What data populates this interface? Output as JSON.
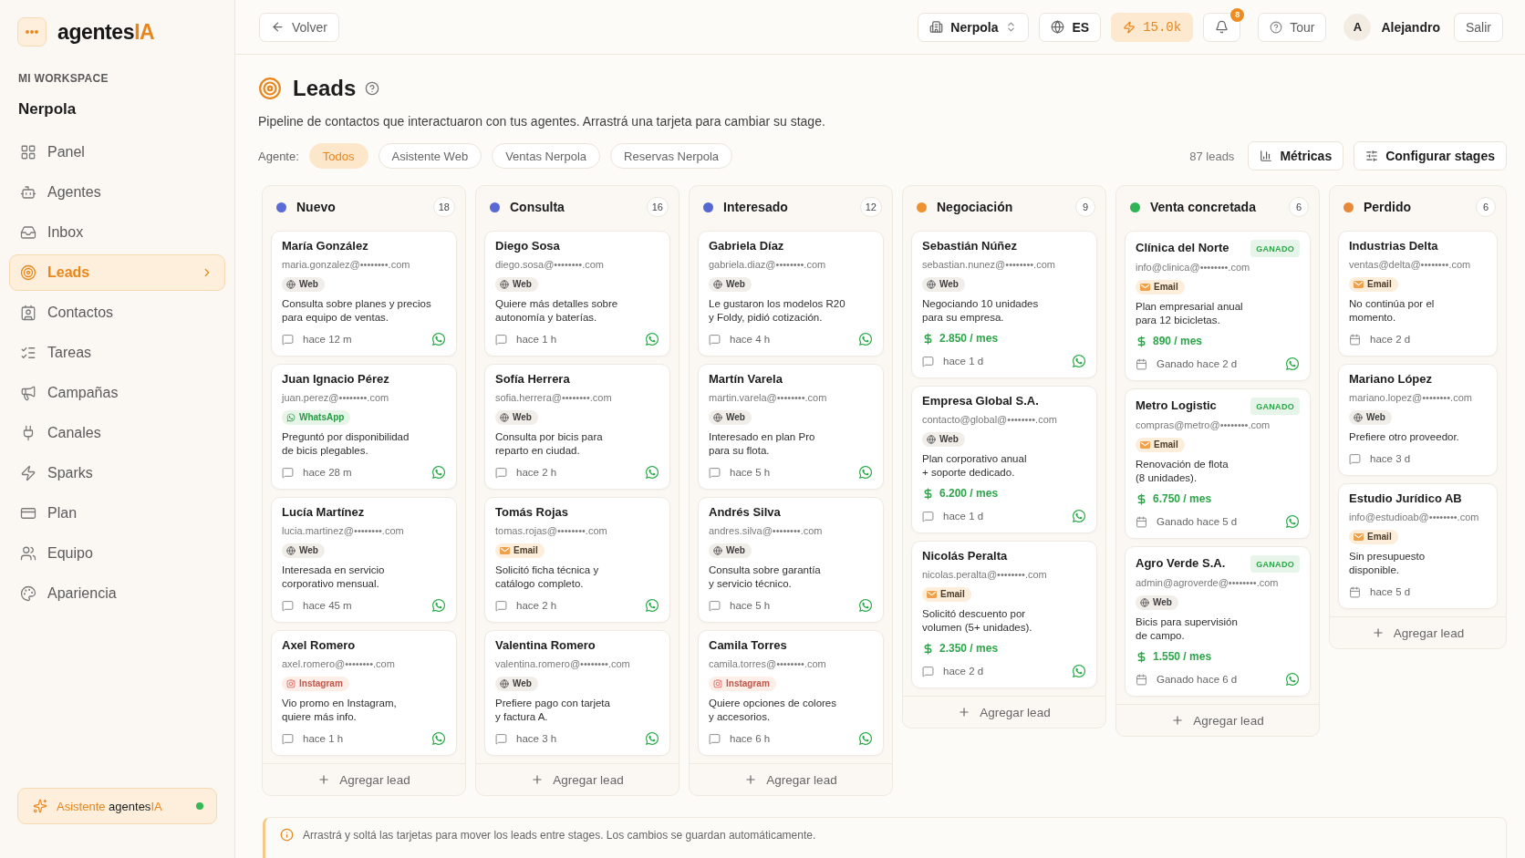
{
  "sidebar": {
    "logo": {
      "name": "agentes",
      "accent": "IA"
    },
    "workspace_label": "MI WORKSPACE",
    "workspace": "Nerpola",
    "items": [
      {
        "label": "Panel",
        "selected": false
      },
      {
        "label": "Agentes",
        "selected": false
      },
      {
        "label": "Inbox",
        "selected": false
      },
      {
        "label": "Leads",
        "selected": true
      },
      {
        "label": "Contactos",
        "selected": false
      },
      {
        "label": "Tareas",
        "selected": false
      },
      {
        "label": "Campañas",
        "selected": false
      },
      {
        "label": "Canales",
        "selected": false
      },
      {
        "label": "Sparks",
        "selected": false
      },
      {
        "label": "Plan",
        "selected": false
      },
      {
        "label": "Equipo",
        "selected": false
      },
      {
        "label": "Apariencia",
        "selected": false
      }
    ],
    "assistant": {
      "label": "Asistente",
      "brand": "agentes",
      "accent": "IA",
      "online": true
    }
  },
  "topbar": {
    "back": "Volver",
    "workspace_select": "Nerpola",
    "language": "ES",
    "credits": "15.0k",
    "notifications": "8",
    "tour": "Tour",
    "user": {
      "initial": "A",
      "name": "Alejandro"
    },
    "logout": "Salir"
  },
  "page": {
    "title": "Leads",
    "description": "Pipeline de contactos que interactuaron con tus agentes. Arrastrá una tarjeta para cambiar su stage.",
    "filter_label": "Agente:",
    "filters": [
      {
        "label": "Todos",
        "selected": true
      },
      {
        "label": "Asistente Web",
        "selected": false
      },
      {
        "label": "Ventas Nerpola",
        "selected": false
      },
      {
        "label": "Reservas Nerpola",
        "selected": false
      }
    ],
    "count": "87 leads",
    "actions": [
      "Métricas",
      "Configurar stages"
    ]
  },
  "stages": [
    {
      "name": "Nuevo",
      "color": "#5a6ad6",
      "count": "18",
      "add_label": "Agregar lead",
      "leads": [
        {
          "name": "María González",
          "email": "maria.gonzalez@••••••••.com",
          "source": {
            "kind": "web",
            "label": "Web"
          },
          "note": "Consulta sobre planes y precios\npara equipo de ventas.",
          "time": "hace 12 m",
          "kind": "open",
          "whatsapp": true
        },
        {
          "name": "Juan Ignacio Pérez",
          "email": "juan.perez@••••••••.com",
          "source": {
            "kind": "whatsapp",
            "label": "WhatsApp"
          },
          "note": "Preguntó por disponibilidad\nde bicis plegables.",
          "time": "hace 28 m",
          "kind": "open",
          "whatsapp": true
        },
        {
          "name": "Lucía Martínez",
          "email": "lucia.martinez@••••••••.com",
          "source": {
            "kind": "web",
            "label": "Web"
          },
          "note": "Interesada en servicio\ncorporativo mensual.",
          "time": "hace 45 m",
          "kind": "open",
          "whatsapp": true
        },
        {
          "name": "Axel Romero",
          "email": "axel.romero@••••••••.com",
          "source": {
            "kind": "instagram",
            "label": "Instagram"
          },
          "note": "Vio promo en Instagram,\nquiere más info.",
          "time": "hace 1 h",
          "kind": "open",
          "whatsapp": true
        }
      ]
    },
    {
      "name": "Consulta",
      "color": "#5868d4",
      "count": "16",
      "add_label": "Agregar lead",
      "leads": [
        {
          "name": "Diego Sosa",
          "email": "diego.sosa@••••••••.com",
          "source": {
            "kind": "web",
            "label": "Web"
          },
          "note": "Quiere más detalles sobre\nautonomía y baterías.",
          "time": "hace 1 h",
          "kind": "open",
          "whatsapp": true
        },
        {
          "name": "Sofía Herrera",
          "email": "sofia.herrera@••••••••.com",
          "source": {
            "kind": "web",
            "label": "Web"
          },
          "note": "Consulta por bicis para\nreparto en ciudad.",
          "time": "hace 2 h",
          "kind": "open",
          "whatsapp": true
        },
        {
          "name": "Tomás Rojas",
          "email": "tomas.rojas@••••••••.com",
          "source": {
            "kind": "email",
            "label": "Email"
          },
          "note": "Solicitó ficha técnica y\ncatálogo completo.",
          "time": "hace 2 h",
          "kind": "open",
          "whatsapp": true
        },
        {
          "name": "Valentina Romero",
          "email": "valentina.romero@••••••••.com",
          "source": {
            "kind": "web",
            "label": "Web"
          },
          "note": "Prefiere pago con tarjeta\ny factura A.",
          "time": "hace 3 h",
          "kind": "open",
          "whatsapp": true
        }
      ]
    },
    {
      "name": "Interesado",
      "color": "#5666d2",
      "count": "12",
      "add_label": "Agregar lead",
      "leads": [
        {
          "name": "Gabriela Díaz",
          "email": "gabriela.diaz@••••••••.com",
          "source": {
            "kind": "web",
            "label": "Web"
          },
          "note": "Le gustaron los modelos R20\ny Foldy, pidió cotización.",
          "time": "hace 4 h",
          "kind": "open",
          "whatsapp": true
        },
        {
          "name": "Martín Varela",
          "email": "martin.varela@••••••••.com",
          "source": {
            "kind": "web",
            "label": "Web"
          },
          "note": "Interesado en plan Pro\npara su flota.",
          "time": "hace 5 h",
          "kind": "open",
          "whatsapp": true
        },
        {
          "name": "Andrés Silva",
          "email": "andres.silva@••••••••.com",
          "source": {
            "kind": "web",
            "label": "Web"
          },
          "note": "Consulta sobre garantía\ny servicio técnico.",
          "time": "hace 5 h",
          "kind": "open",
          "whatsapp": true
        },
        {
          "name": "Camila Torres",
          "email": "camila.torres@••••••••.com",
          "source": {
            "kind": "instagram",
            "label": "Instagram"
          },
          "note": "Quiere opciones de colores\ny accesorios.",
          "time": "hace 6 h",
          "kind": "open",
          "whatsapp": true
        }
      ]
    },
    {
      "name": "Negociación",
      "color": "#ee9130",
      "count": "9",
      "add_label": "Agregar lead",
      "leads": [
        {
          "name": "Sebastián Núñez",
          "email": "sebastian.nunez@••••••••.com",
          "source": {
            "kind": "web",
            "label": "Web"
          },
          "note": "Negociando 10 unidades\npara su empresa.",
          "value": "2.850 / mes",
          "time": "hace 1 d",
          "kind": "open",
          "whatsapp": true
        },
        {
          "name": "Empresa Global S.A.",
          "email": "contacto@global@••••••••.com",
          "source": {
            "kind": "web",
            "label": "Web"
          },
          "note": "Plan corporativo anual\n+ soporte dedicado.",
          "value": "6.200 / mes",
          "time": "hace 1 d",
          "kind": "open",
          "whatsapp": true
        },
        {
          "name": "Nicolás Peralta",
          "email": "nicolas.peralta@••••••••.com",
          "source": {
            "kind": "email",
            "label": "Email"
          },
          "note": "Solicitó descuento por\nvolumen (5+ unidades).",
          "value": "2.350 / mes",
          "time": "hace 2 d",
          "kind": "open",
          "whatsapp": true
        }
      ]
    },
    {
      "name": "Venta concretada",
      "color": "#2fb356",
      "count": "6",
      "add_label": "Agregar lead",
      "leads": [
        {
          "name": "Clínica del Norte",
          "badge": "GANADO",
          "email": "info@clinica@••••••••.com",
          "source": {
            "kind": "email",
            "label": "Email"
          },
          "note": "Plan empresarial anual\npara 12 bicicletas.",
          "value": "890 / mes",
          "time": "Ganado hace 2 d",
          "kind": "closed",
          "whatsapp": true
        },
        {
          "name": "Metro Logistic",
          "badge": "GANADO",
          "email": "compras@metro@••••••••.com",
          "source": {
            "kind": "email",
            "label": "Email"
          },
          "note": "Renovación de flota\n(8 unidades).",
          "value": "6.750 / mes",
          "time": "Ganado hace 5 d",
          "kind": "closed",
          "whatsapp": true
        },
        {
          "name": "Agro Verde S.A.",
          "badge": "GANADO",
          "email": "admin@agroverde@••••••••.com",
          "source": {
            "kind": "web",
            "label": "Web"
          },
          "note": "Bicis para supervisión\nde campo.",
          "value": "1.550 / mes",
          "time": "Ganado hace 6 d",
          "kind": "closed",
          "whatsapp": true
        }
      ]
    },
    {
      "name": "Perdido",
      "color": "#e8893a",
      "count": "6",
      "add_label": "Agregar lead",
      "leads": [
        {
          "name": "Industrias Delta",
          "email": "ventas@delta@••••••••.com",
          "source": {
            "kind": "email",
            "label": "Email"
          },
          "note": "No continúa por el\nmomento.",
          "time": "hace 2 d",
          "kind": "closed",
          "whatsapp": false
        },
        {
          "name": "Mariano López",
          "email": "mariano.lopez@••••••••.com",
          "source": {
            "kind": "web",
            "label": "Web"
          },
          "note": "Prefiere otro proveedor.",
          "time": "hace 3 d",
          "kind": "open",
          "whatsapp": false
        },
        {
          "name": "Estudio Jurídico AB",
          "email": "info@estudioab@••••••••.com",
          "source": {
            "kind": "email",
            "label": "Email"
          },
          "note": "Sin presupuesto\ndisponible.",
          "time": "hace 5 d",
          "kind": "closed",
          "whatsapp": false
        }
      ]
    }
  ],
  "notice": "Arrastrá y soltá las tarjetas para mover los leads entre stages. Los cambios se guardan automáticamente."
}
